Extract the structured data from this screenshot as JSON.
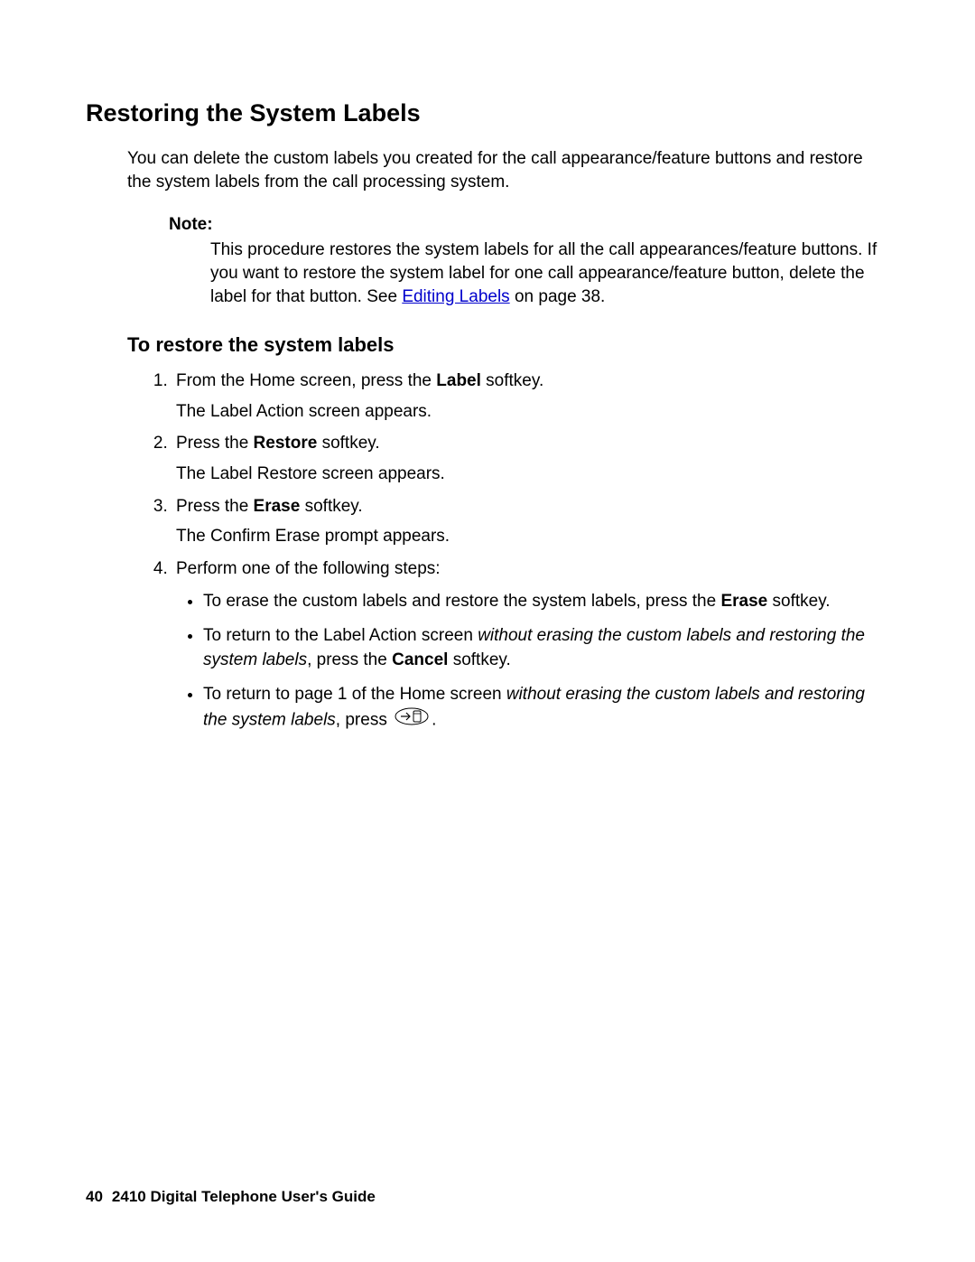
{
  "heading": "Restoring the System Labels",
  "intro": "You can delete the custom labels you created for the call appearance/feature buttons and restore the system labels from the call processing system.",
  "note": {
    "label": "Note:",
    "body_pre": "This procedure restores the system labels for all the call appearances/feature buttons. If you want to restore the system label for one call appearance/feature button, delete the label for that button. See ",
    "link_text": "Editing Labels",
    "body_post": " on page 38."
  },
  "subheading": "To restore the system labels",
  "steps": {
    "s1": {
      "pre": "From the Home screen, press the ",
      "bold": "Label",
      "post": " softkey.",
      "result": "The Label Action screen appears."
    },
    "s2": {
      "pre": "Press the ",
      "bold": "Restore",
      "post": " softkey.",
      "result": "The Label Restore screen appears."
    },
    "s3": {
      "pre": "Press the ",
      "bold": "Erase",
      "post": " softkey.",
      "result": "The Confirm Erase prompt appears."
    },
    "s4": {
      "lead": "Perform one of the following steps:",
      "b1": {
        "pre": "To erase the custom labels and restore the system labels, press the ",
        "bold": "Erase",
        "post": " softkey."
      },
      "b2": {
        "pre": "To return to the Label Action screen ",
        "ital": "without erasing the custom labels and restoring the system labels",
        "mid": ", press the ",
        "bold": "Cancel",
        "post": " softkey."
      },
      "b3": {
        "pre": "To return to page 1 of the Home screen ",
        "ital": "without erasing the custom labels and restoring the system labels",
        "mid": ", press ",
        "post": "."
      }
    }
  },
  "footer": {
    "page_number": "40",
    "doc_title": "2410 Digital Telephone User's Guide"
  }
}
